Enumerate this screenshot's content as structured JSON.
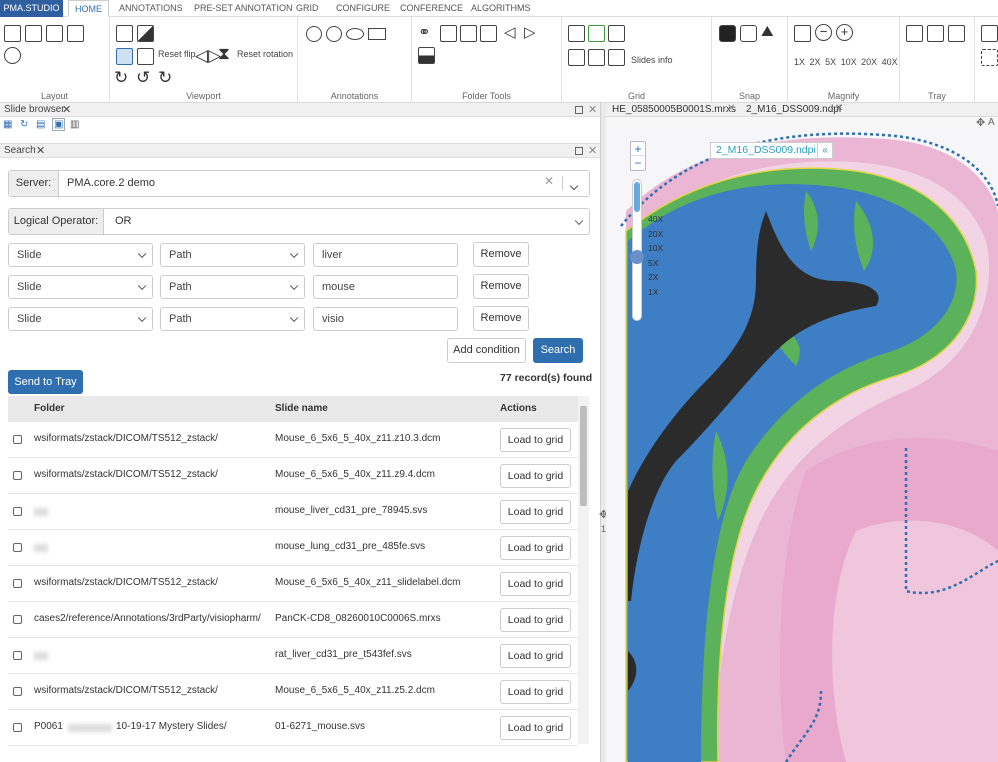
{
  "app": {
    "brand": "PMA.STUDIO"
  },
  "tabs": [
    "HOME",
    "ANNOTATIONS",
    "PRE-SET ANNOTATION",
    "GRID",
    "CONFIGURE",
    "CONFERENCE",
    "ALGORITHMS"
  ],
  "ribbon": {
    "groups": [
      "Layout",
      "Viewport",
      "Annotations",
      "Folder Tools",
      "Grid",
      "Snap",
      "Magnify",
      "Tray"
    ],
    "reset_flip": "Reset flip",
    "reset_rotation": "Reset rotation",
    "slides_info": "Slides info",
    "magnify_levels": [
      "1X",
      "2X",
      "5X",
      "10X",
      "20X",
      "40X"
    ]
  },
  "slide_browser": {
    "title": "Slide browser"
  },
  "search": {
    "title": "Search",
    "server_label": "Server:",
    "server_value": "PMA.core.2 demo",
    "logical_label": "Logical Operator:",
    "logical_value": "OR",
    "conditions": [
      {
        "field": "Slide",
        "attr": "Path",
        "value": "liver",
        "remove": "Remove"
      },
      {
        "field": "Slide",
        "attr": "Path",
        "value": "mouse",
        "remove": "Remove"
      },
      {
        "field": "Slide",
        "attr": "Path",
        "value": "visio",
        "remove": "Remove"
      }
    ],
    "add_condition": "Add condition",
    "search_button": "Search",
    "send_to_tray": "Send to Tray",
    "records_found": "77 record(s) found",
    "columns": [
      "Folder",
      "Slide name",
      "Actions"
    ],
    "rows": [
      {
        "folder": "wsiformats/zstack/DICOM/TS512_zstack/",
        "slide": "Mouse_6_5x6_5_40x_z11.z10.3.dcm",
        "action": "Load to grid"
      },
      {
        "folder": "wsiformats/zstack/DICOM/TS512_zstack/",
        "slide": "Mouse_6_5x6_5_40x_z11.z9.4.dcm",
        "action": "Load to grid"
      },
      {
        "folder": "",
        "slide": "mouse_liver_cd31_pre_78945.svs",
        "action": "Load to grid"
      },
      {
        "folder": "",
        "slide": "mouse_lung_cd31_pre_485fe.svs",
        "action": "Load to grid"
      },
      {
        "folder": "wsiformats/zstack/DICOM/TS512_zstack/",
        "slide": "Mouse_6_5x6_5_40x_z11_slidelabel.dcm",
        "action": "Load to grid"
      },
      {
        "folder": "cases2/reference/Annotations/3rdParty/visiopharm/",
        "slide": "PanCK-CD8_08260010C0006S.mrxs",
        "action": "Load to grid"
      },
      {
        "folder": "",
        "slide": "rat_liver_cd31_pre_t543fef.svs",
        "action": "Load to grid"
      },
      {
        "folder": "wsiformats/zstack/DICOM/TS512_zstack/",
        "slide": "Mouse_6_5x6_5_40x_z11.z5.2.dcm",
        "action": "Load to grid"
      },
      {
        "folder": "P0061",
        "folder_tail": "10-19-17 Mystery Slides/",
        "slide": "01-6271_mouse.svs",
        "action": "Load to grid"
      }
    ]
  },
  "viewer": {
    "tabs": [
      "HE_05850005B0001S.mrxs",
      "2_M16_DSS009.ndpi"
    ],
    "slide_label": "2_M16_DSS009.ndpi",
    "zoom_levels": [
      "40X",
      "20X",
      "10X",
      "5X",
      "2X",
      "1X"
    ],
    "zoom_current": "5X",
    "zoom_in": "+",
    "zoom_out": "−",
    "collapse": "«",
    "grid_cell": "1",
    "corner": "A"
  },
  "colors": {
    "accent": "#2f6fb0",
    "brand": "#2f5f9e",
    "tissue_blue": "#3d7ec4",
    "tissue_green": "#4aa84a",
    "stroma_pink": "#e7a3c9"
  }
}
